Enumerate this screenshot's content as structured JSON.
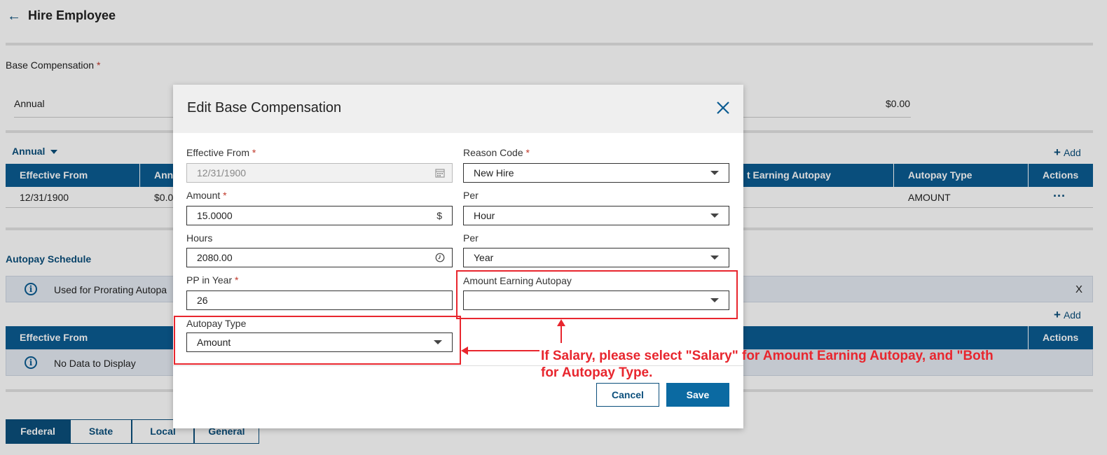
{
  "page": {
    "title": "Hire Employee",
    "base_comp_label": "Base Compensation",
    "annual_row": {
      "label": "Annual",
      "value": "$0.00"
    },
    "annual_dropdown": "Annual",
    "add_label": "Add",
    "comp_table": {
      "headers": [
        "Effective From",
        "Ann",
        "t Earning Autopay",
        "Autopay Type",
        "Actions"
      ],
      "row": {
        "effective_from": "12/31/1900",
        "amount": "$0.0",
        "autopay_type": "AMOUNT",
        "actions": "···"
      }
    },
    "autopay_schedule_label": "Autopay Schedule",
    "info_message": "Used for Prorating Autopa",
    "info_close": "X",
    "schedule_table": {
      "headers": [
        "Effective From",
        "Actions"
      ],
      "empty_message": "No Data to Display"
    },
    "tabs": [
      "Federal",
      "State",
      "Local",
      "General"
    ]
  },
  "modal": {
    "title": "Edit Base Compensation",
    "effective_from": {
      "label": "Effective From",
      "value": "12/31/1900"
    },
    "reason_code": {
      "label": "Reason Code",
      "value": "New Hire"
    },
    "amount": {
      "label": "Amount",
      "value": "15.0000",
      "suffix": "$"
    },
    "per1": {
      "label": "Per",
      "value": "Hour"
    },
    "hours": {
      "label": "Hours",
      "value": "2080.00"
    },
    "per2": {
      "label": "Per",
      "value": "Year"
    },
    "pp_in_year": {
      "label": "PP in Year",
      "value": "26"
    },
    "amount_earning_autopay": {
      "label": "Amount Earning Autopay",
      "value": ""
    },
    "autopay_type": {
      "label": "Autopay Type",
      "value": "Amount"
    },
    "cancel_label": "Cancel",
    "save_label": "Save"
  },
  "annotation": {
    "line1": "If Salary, please select \"Salary\" for Amount Earning Autopay, and \"Both",
    "line2": "for Autopay Type.",
    "color": "#e8262e"
  }
}
